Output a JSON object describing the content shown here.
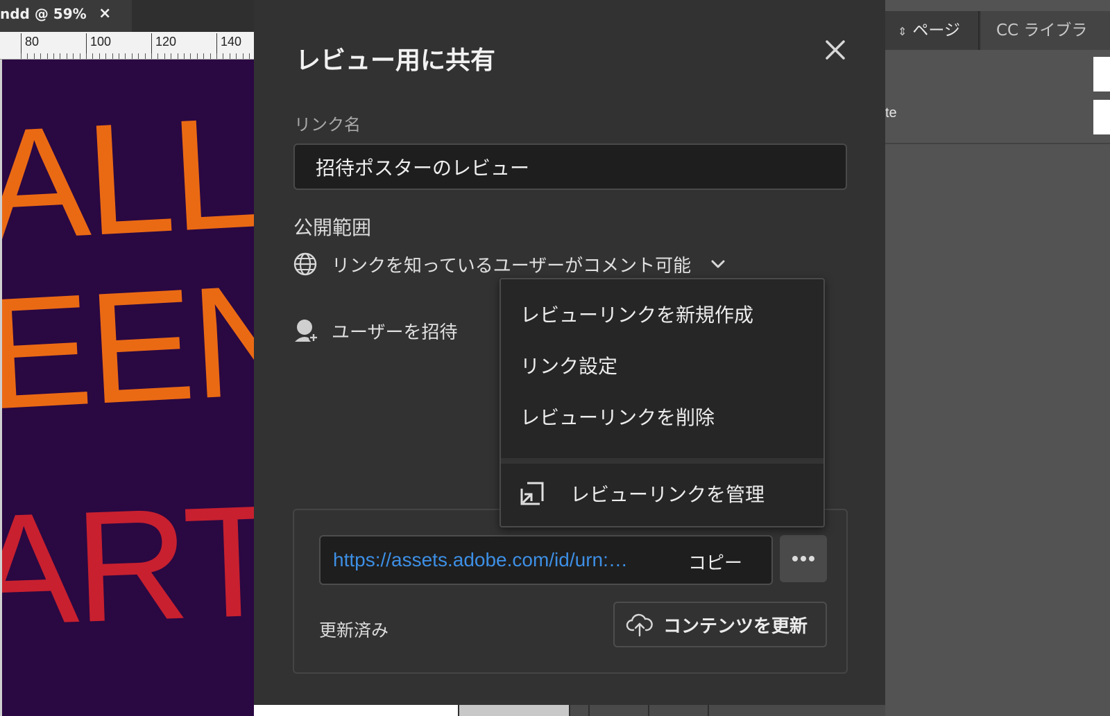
{
  "document": {
    "tab_title": "ndd @ 59%",
    "tab_close": "×",
    "ruler_labels": [
      "80",
      "100",
      "120",
      "140"
    ],
    "poster_lines": [
      "ALLO",
      "EEN",
      "ARTY"
    ]
  },
  "right_panel": {
    "tabs": [
      {
        "label": "ページ",
        "active": true
      },
      {
        "label": "CC ライブラ",
        "active": false
      }
    ],
    "row_text": "te"
  },
  "dialog": {
    "title": "レビュー用に共有",
    "close_icon": "close-icon",
    "link_name_label": "リンク名",
    "link_name_value": "招待ポスターのレビュー",
    "scope_label": "公開範囲",
    "scope_value": "リンクを知っているユーザーがコメント可能",
    "invite_label": "ユーザーを招待",
    "link_url": "https://assets.adobe.com/id/urn:…",
    "copy_label": "コピー",
    "updated_status": "更新済み",
    "update_button_label": "コンテンツを更新"
  },
  "menu": {
    "items": [
      "レビューリンクを新規作成",
      "リンク設定",
      "レビューリンクを削除"
    ],
    "manage_label": "レビューリンクを管理"
  },
  "colors": {
    "dialog_bg": "#323232",
    "link_blue": "#3d8fe5",
    "poster_bg": "#2a0842",
    "poster_orange": "#ea6a14",
    "poster_red": "#c8202f"
  }
}
